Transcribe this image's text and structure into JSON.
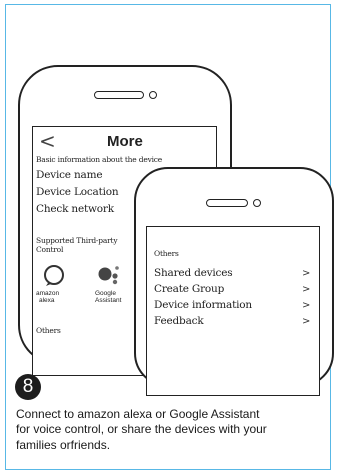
{
  "step": {
    "number": "8"
  },
  "settings_screen": {
    "back_label": "<",
    "title": "More",
    "basic_info_heading": "Basic information about the device",
    "items": [
      "Device name",
      "Device Location",
      "Check network"
    ],
    "supported_heading_line1": "Supported Third-party",
    "supported_heading_line2": "Control",
    "assistants": [
      {
        "name": "amazon alexa",
        "label_line1": "amazon",
        "label_line2": "alexa",
        "icon": "alexa-icon"
      },
      {
        "name": "Google Assistant",
        "label_line1": "Google",
        "label_line2": "Assistant",
        "icon": "google-assistant-icon"
      }
    ],
    "others_heading": "Others"
  },
  "others_screen": {
    "heading": "Others",
    "items": [
      {
        "label": "Shared devices",
        "chevron": ">"
      },
      {
        "label": "Create Group",
        "chevron": ">"
      },
      {
        "label": "Device information",
        "chevron": ">"
      },
      {
        "label": "Feedback",
        "chevron": ">"
      }
    ]
  },
  "caption": {
    "line1": "Connect to amazon  alexa  or Google Assistant",
    "line2": "for voice control, or share the devices with your",
    "line3": "families orfriends."
  },
  "colors": {
    "frame_border": "#58b8e6",
    "badge_bg": "#1d1d1d",
    "outline": "#222222"
  }
}
